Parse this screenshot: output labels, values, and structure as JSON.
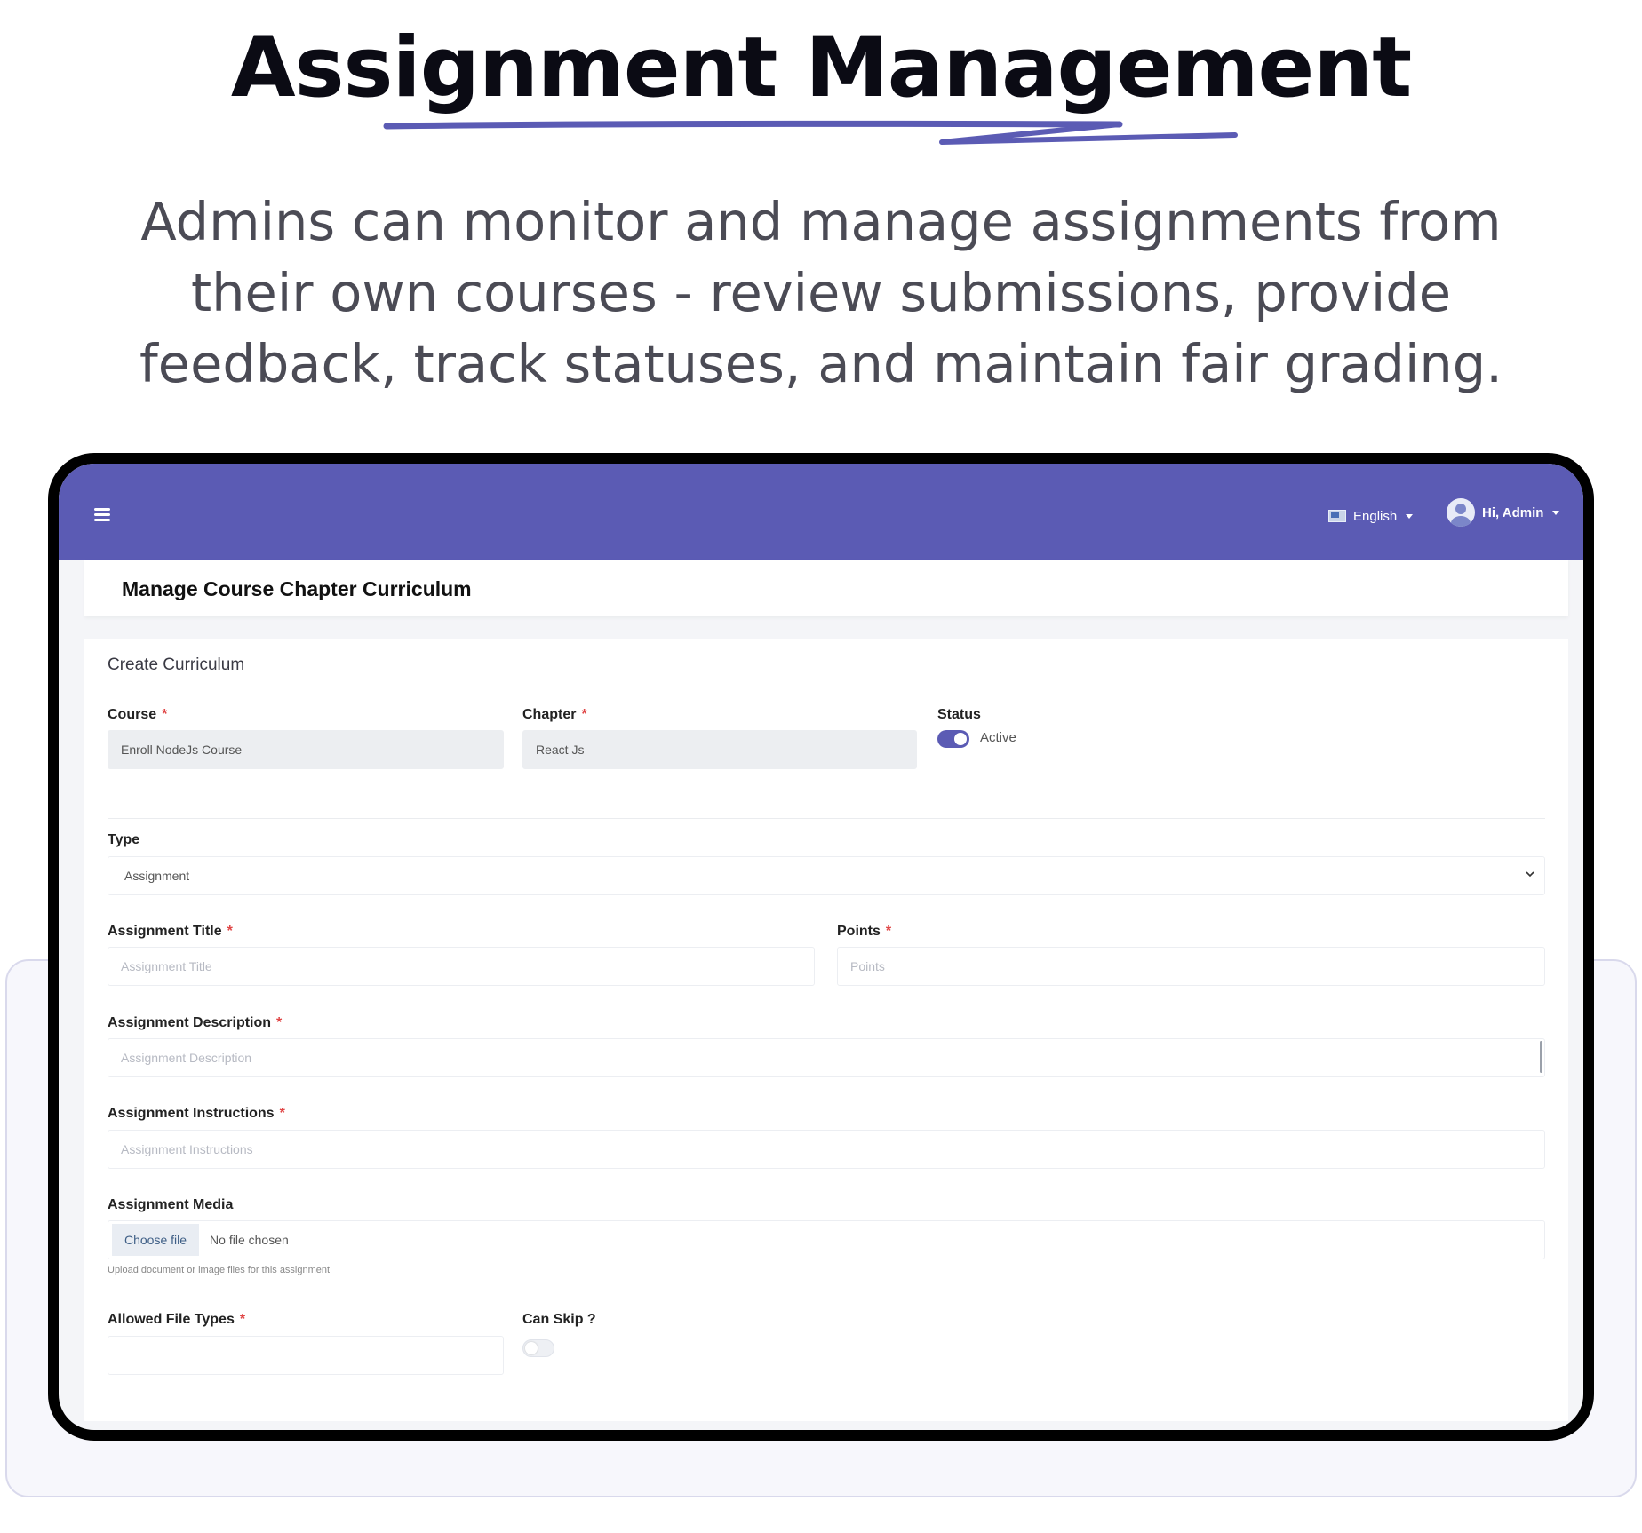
{
  "hero": {
    "title": "Assignment Management",
    "description": "Admins can monitor and manage assignments from their own courses - review submissions, provide feedback, track statuses, and maintain fair grading."
  },
  "colors": {
    "accent": "#5b5bb4",
    "required": "#e04646"
  },
  "topbar": {
    "menu_icon": "hamburger-icon",
    "language": "English",
    "user": "Hi, Admin"
  },
  "page": {
    "title": "Manage Course Chapter Curriculum"
  },
  "form": {
    "title": "Create Curriculum",
    "course": {
      "label": "Course",
      "value": "Enroll NodeJs Course"
    },
    "chapter": {
      "label": "Chapter",
      "value": "React Js"
    },
    "status": {
      "label": "Status",
      "state_label": "Active",
      "on": true
    },
    "type": {
      "label": "Type",
      "value": "Assignment"
    },
    "assignment_title": {
      "label": "Assignment Title",
      "placeholder": "Assignment Title"
    },
    "points": {
      "label": "Points",
      "placeholder": "Points"
    },
    "description": {
      "label": "Assignment Description",
      "placeholder": "Assignment Description"
    },
    "instructions": {
      "label": "Assignment Instructions",
      "placeholder": "Assignment Instructions"
    },
    "media": {
      "label": "Assignment Media",
      "button": "Choose file",
      "file_status": "No file chosen",
      "help": "Upload document or image files for this assignment"
    },
    "allowed_types": {
      "label": "Allowed File Types",
      "value": ""
    },
    "can_skip": {
      "label": "Can Skip ?",
      "on": false
    },
    "required_mark": "*"
  }
}
